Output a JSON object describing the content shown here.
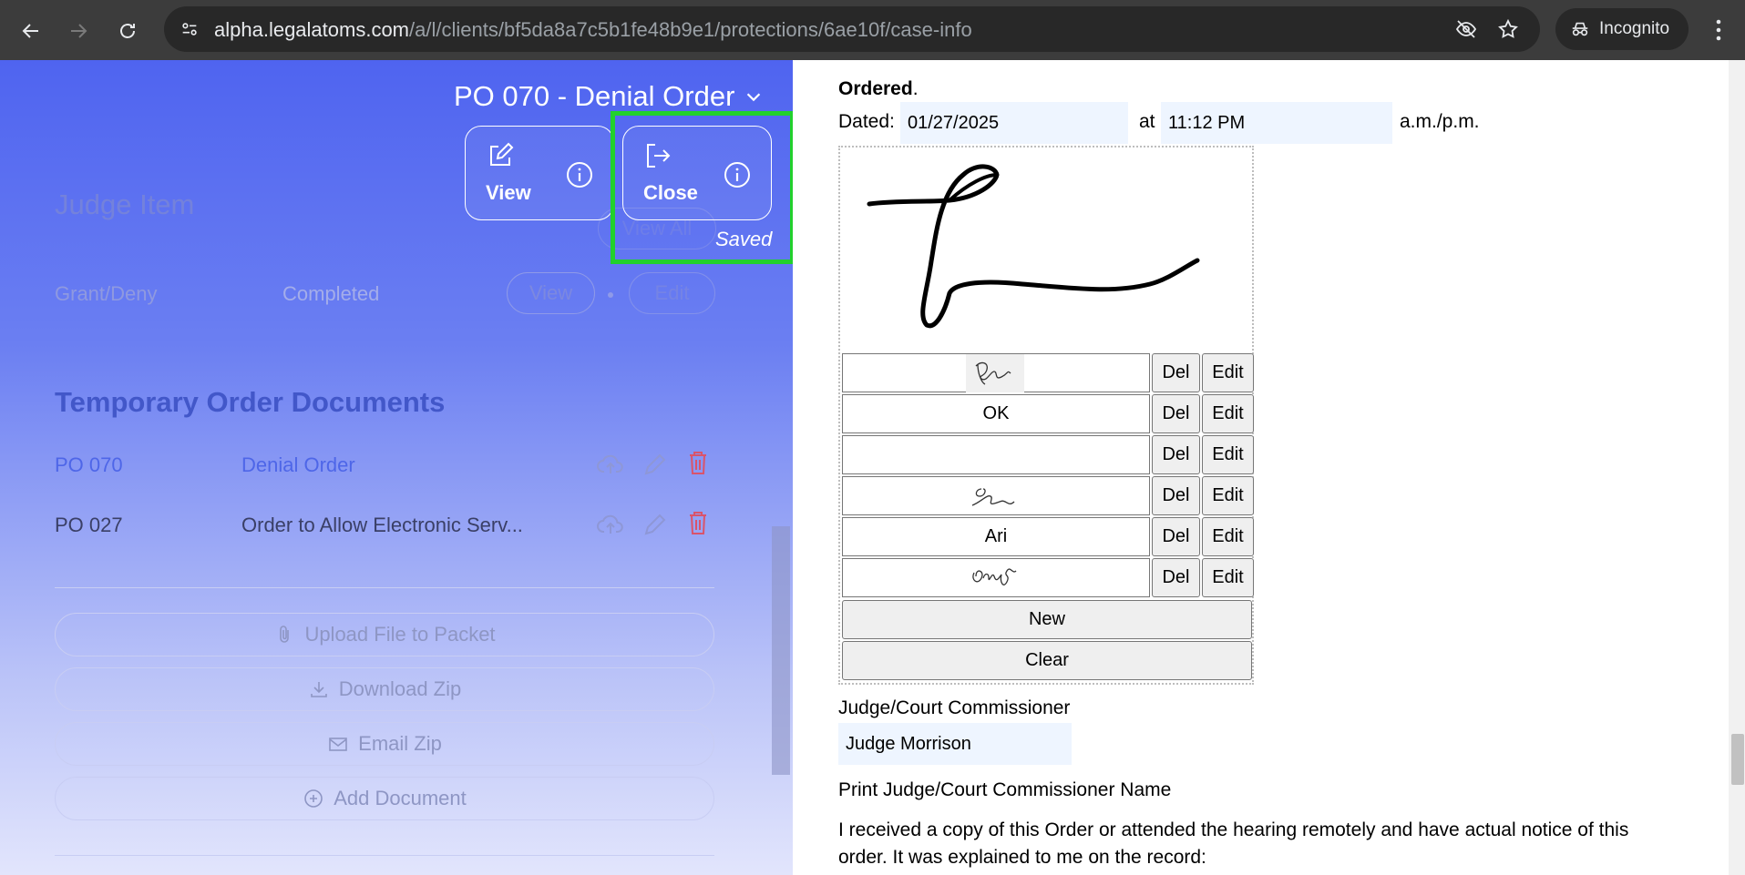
{
  "browser": {
    "url_host": "alpha.legalatoms.com",
    "url_path": "/a/l/clients/bf5da8a7c5b1fe48b9e1/protections/6ae10f/case-info",
    "incognito_label": "Incognito"
  },
  "app": {
    "doc_title": "PO 070 - Denial Order",
    "view_card_label": "View",
    "close_card_label": "Close",
    "saved_label": "Saved",
    "judge_section": {
      "heading": "Judge Item",
      "view_all_label": "View All",
      "row": {
        "name": "Grant/Deny",
        "status": "Completed",
        "view_label": "View",
        "edit_label": "Edit"
      }
    },
    "temp_docs": {
      "heading": "Temporary Order Documents",
      "rows": [
        {
          "code": "PO 070",
          "title": "Denial Order"
        },
        {
          "code": "PO 027",
          "title": "Order to Allow Electronic Serv..."
        }
      ]
    },
    "actions": {
      "upload": "Upload File to Packet",
      "download": "Download Zip",
      "email": "Email Zip",
      "add": "Add Document"
    }
  },
  "document": {
    "ordered": "Ordered",
    "ordered_period": ".",
    "dated_label": "Dated:",
    "dated_value": "01/27/2025",
    "at_label": "at",
    "time_value": "11:12 PM",
    "ampm_label": "a.m./p.m.",
    "signature_rows": [
      {
        "text": "",
        "kind": "sig-a"
      },
      {
        "text": "OK",
        "kind": "text"
      },
      {
        "text": "",
        "kind": "blank"
      },
      {
        "text": "",
        "kind": "sig-b"
      },
      {
        "text": "Ari",
        "kind": "text"
      },
      {
        "text": "",
        "kind": "sig-c"
      }
    ],
    "del_label": "Del",
    "edit_label": "Edit",
    "new_label": "New",
    "clear_label": "Clear",
    "judge_label": "Judge/Court Commissioner",
    "judge_value": "Judge Morrison",
    "print_name_label": "Print Judge/Court Commissioner Name",
    "receipt_line1": "I received a copy of this Order or attended the hearing remotely and have actual notice of this",
    "receipt_line2": "order. It was explained to me on the record:"
  }
}
